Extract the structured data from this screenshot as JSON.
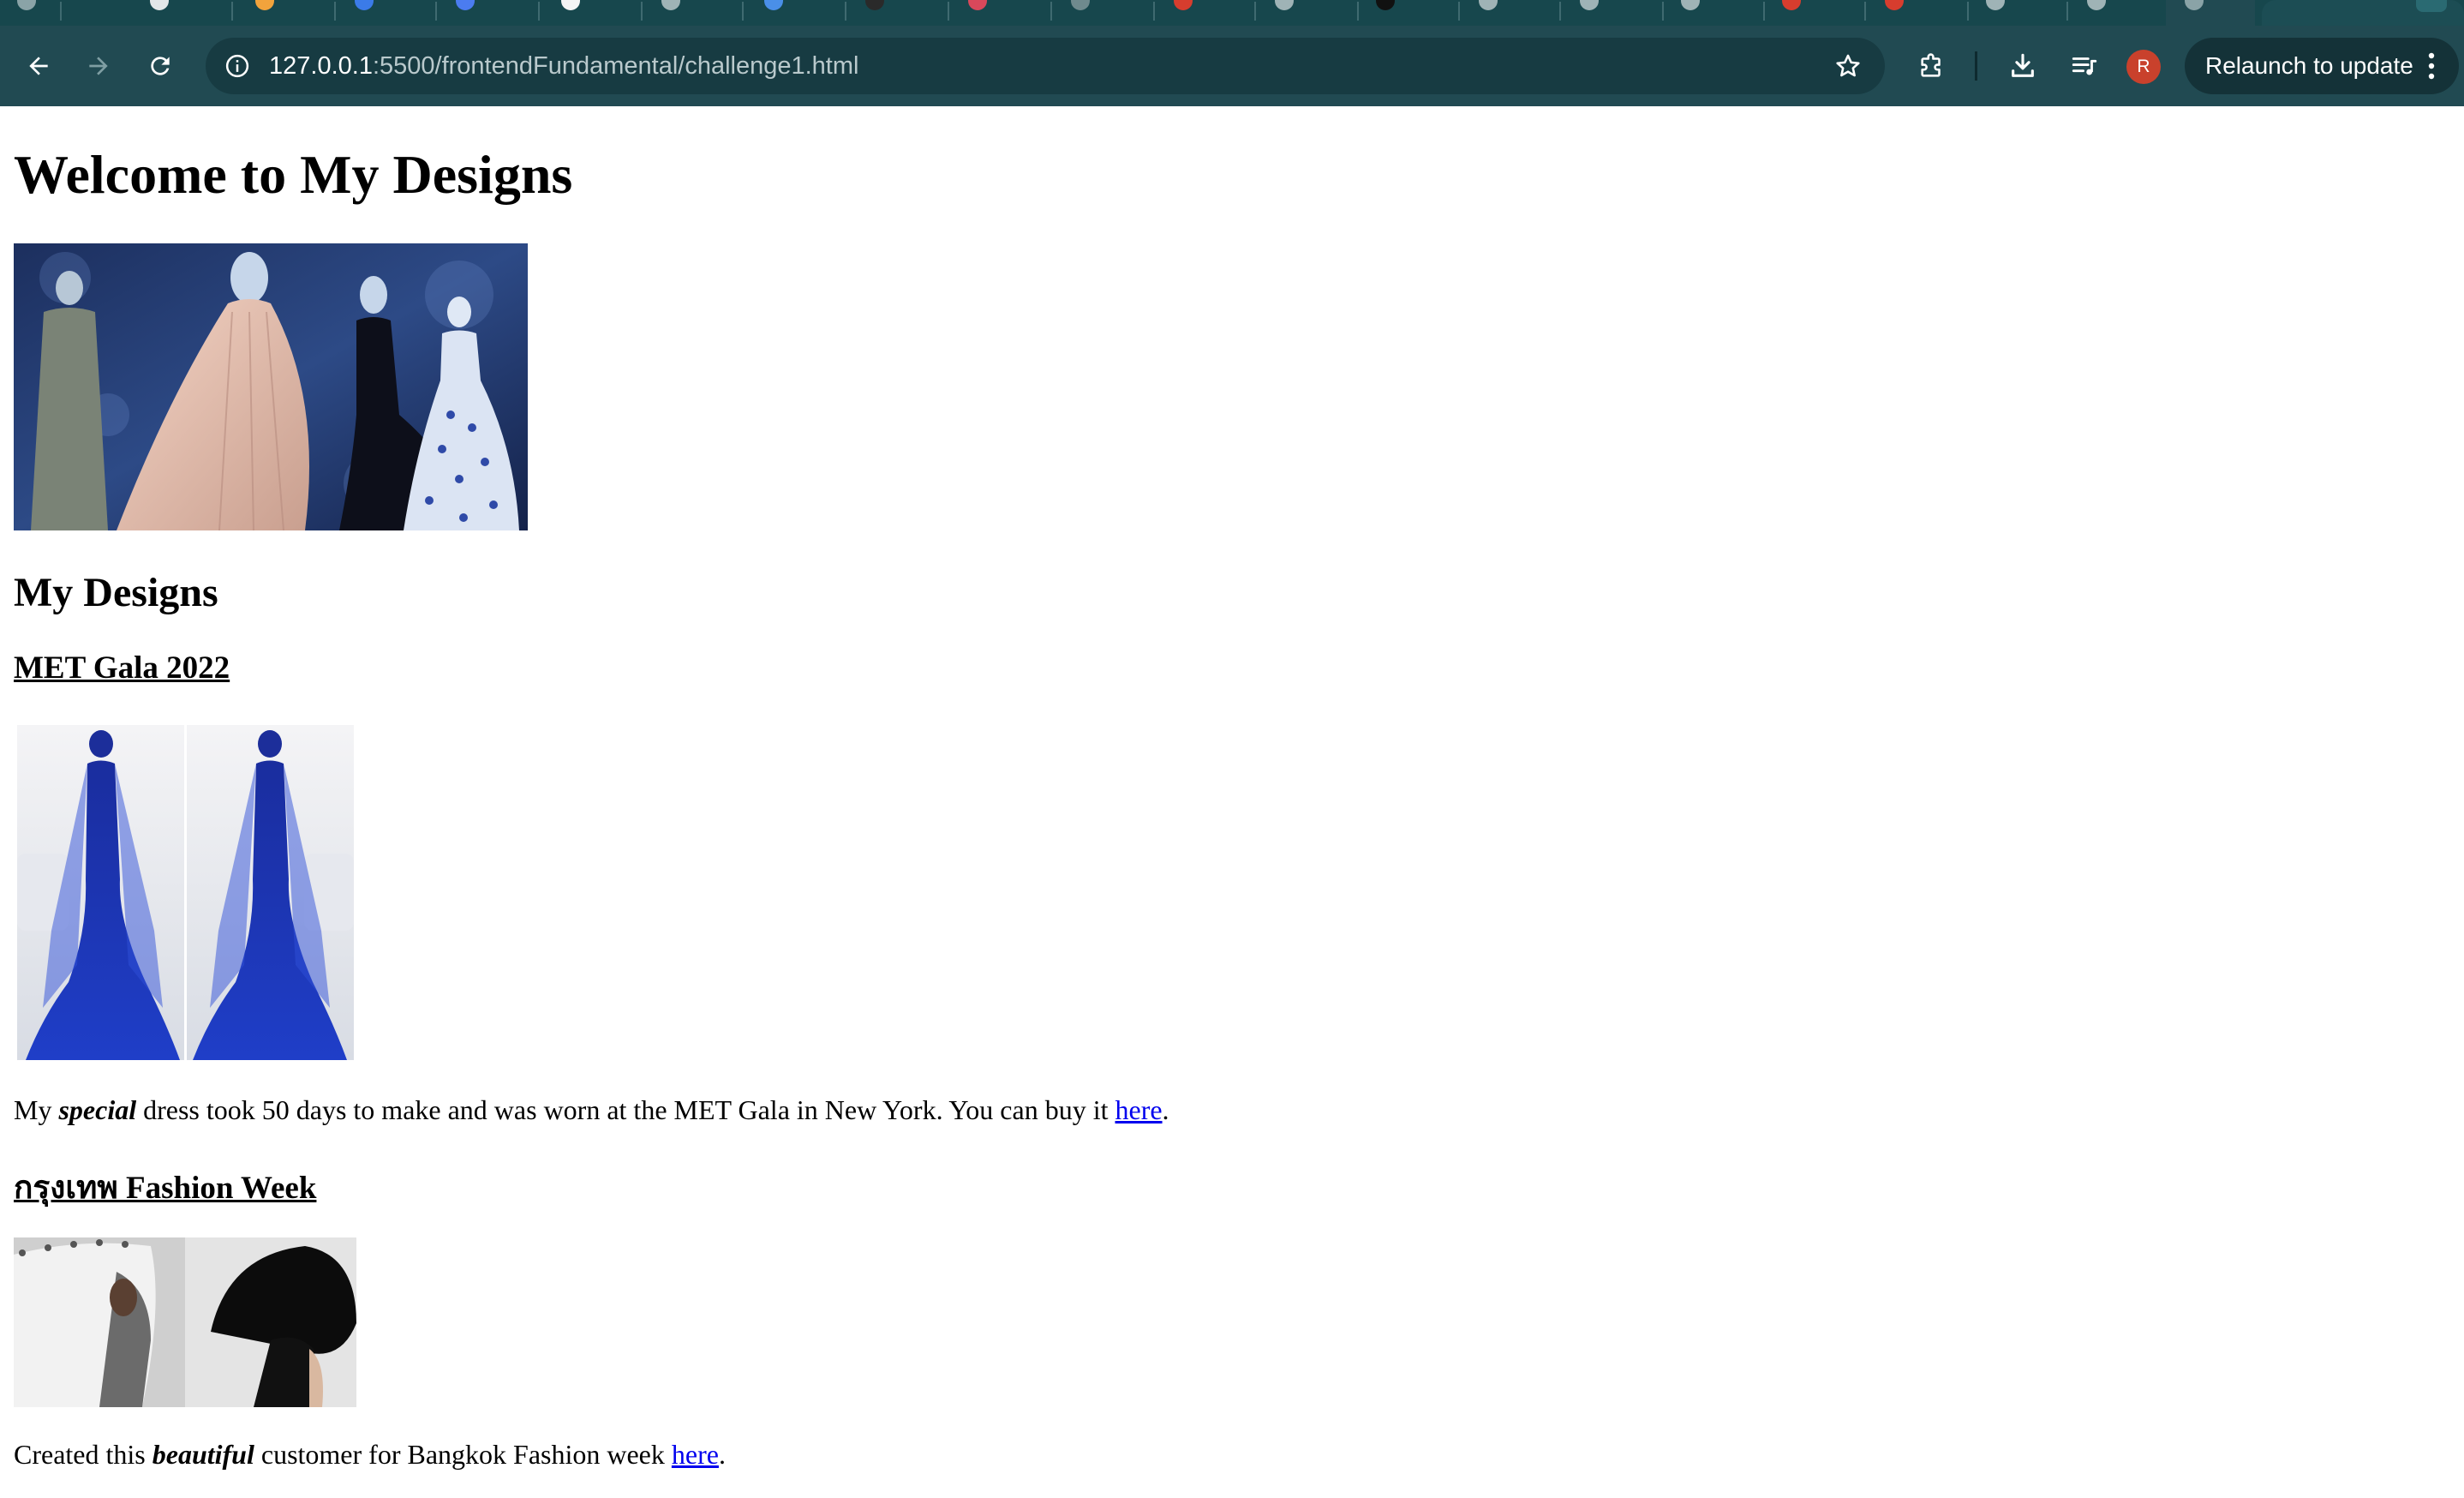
{
  "browser": {
    "url_host": "127.0.0.1",
    "url_path": ":5500/frontendFundamental/challenge1.html",
    "profile_initial": "R",
    "relaunch_label": "Relaunch to update",
    "icons": {
      "back": "arrow-left-icon",
      "forward": "arrow-right-icon",
      "reload": "reload-icon",
      "site_info": "info-icon",
      "bookmark": "star-icon",
      "extensions": "puzzle-icon",
      "downloads": "download-icon",
      "media": "playlist-icon",
      "menu": "more-vertical-icon"
    }
  },
  "page": {
    "heading": "Welcome to My Designs",
    "section_title": "My Designs",
    "items": [
      {
        "title": "MET Gala 2022",
        "text_before": "My ",
        "emphasis": "special",
        "text_after": " dress took 50 days to make and was worn at the MET Gala in New York. You can buy it ",
        "link": "here",
        "end": "."
      },
      {
        "title": "กรุงเทพ Fashion Week",
        "text_before": "Created this ",
        "emphasis": "beautiful",
        "text_after": " customer for Bangkok Fashion week ",
        "link": "here",
        "end": "."
      }
    ]
  }
}
